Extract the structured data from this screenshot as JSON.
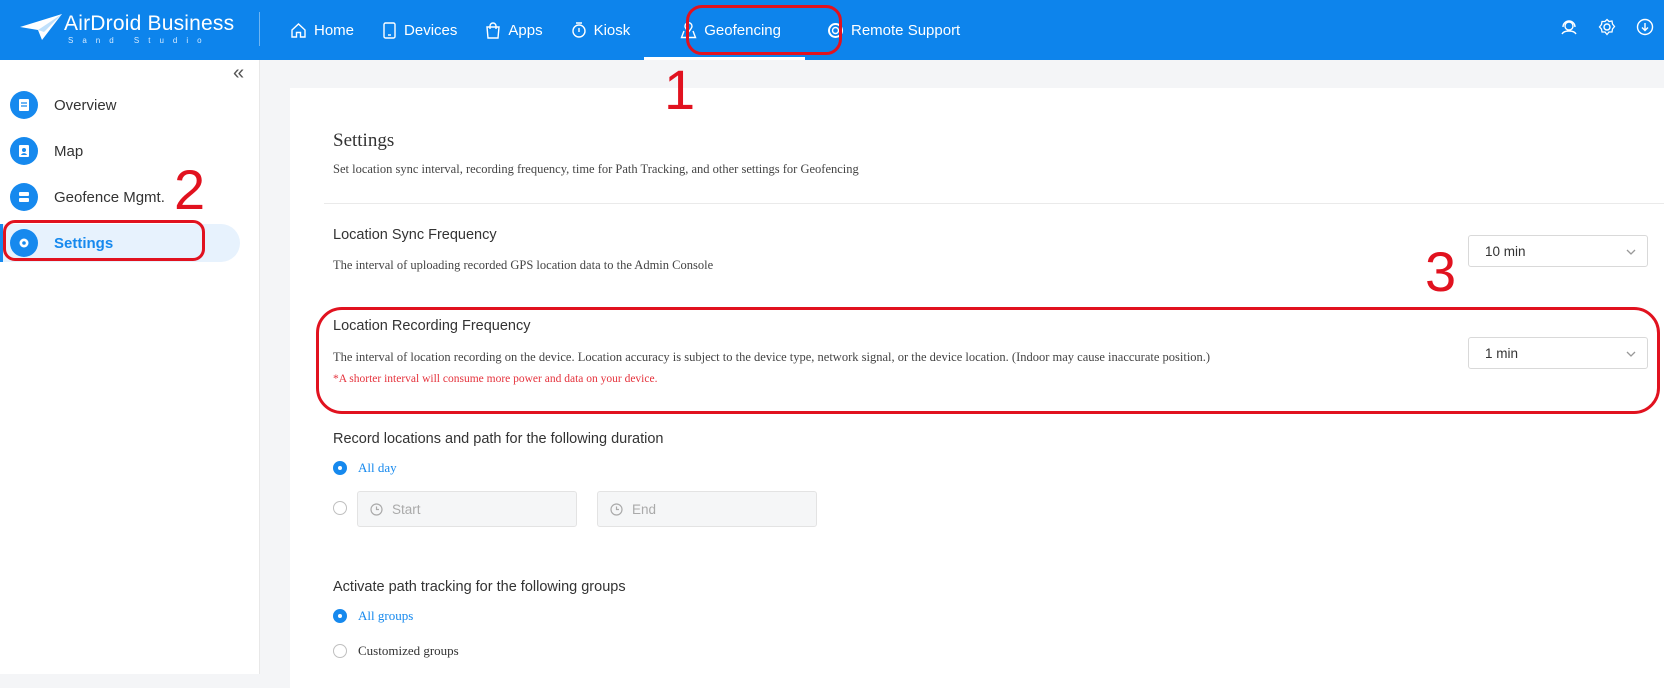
{
  "app": {
    "brand": "AirDroid Business",
    "brand_sub": "Sand Studio"
  },
  "nav": {
    "items": [
      {
        "label": "Home",
        "icon": "home-icon"
      },
      {
        "label": "Devices",
        "icon": "device-icon"
      },
      {
        "label": "Apps",
        "icon": "bag-icon"
      },
      {
        "label": "Kiosk",
        "icon": "kiosk-icon"
      },
      {
        "label": "Geofencing",
        "icon": "map-pin-icon",
        "active": true
      },
      {
        "label": "Remote Support",
        "icon": "lifebuoy-icon"
      }
    ],
    "right_icons": [
      "support-agent-icon",
      "gear-icon",
      "download-icon"
    ]
  },
  "sidebar": {
    "collapse_icon": "double-chevron-left-icon",
    "items": [
      {
        "label": "Overview",
        "icon": "overview-icon"
      },
      {
        "label": "Map",
        "icon": "map-icon"
      },
      {
        "label": "Geofence Mgmt.",
        "icon": "geofence-icon"
      },
      {
        "label": "Settings",
        "icon": "gear-icon",
        "active": true
      }
    ]
  },
  "settings": {
    "title": "Settings",
    "description": "Set location sync interval, recording frequency, time for Path Tracking, and other settings for Geofencing",
    "sync": {
      "title": "Location Sync Frequency",
      "description": "The interval of uploading recorded GPS location data to the Admin Console",
      "value": "10 min"
    },
    "recording": {
      "title": "Location Recording Frequency",
      "description": "The interval of location recording on the device. Location accuracy is subject to the device type, network signal, or the device location. (Indoor may cause inaccurate position.)",
      "warning": "*A shorter interval will consume more power and data on your device.",
      "value": "1 min"
    },
    "duration": {
      "title": "Record locations and path for the following duration",
      "option_all_day": "All day",
      "start_placeholder": "Start",
      "end_placeholder": "End",
      "selected": "All day"
    },
    "groups": {
      "title": "Activate path tracking for the following groups",
      "option_all": "All groups",
      "option_custom": "Customized groups",
      "selected": "All groups"
    }
  },
  "annotations": {
    "labels": [
      "1",
      "2",
      "3"
    ],
    "color": "#e1121f"
  },
  "colors": {
    "topbar": "#0d84ec",
    "accent": "#1689ee",
    "warning": "#e5333d"
  }
}
